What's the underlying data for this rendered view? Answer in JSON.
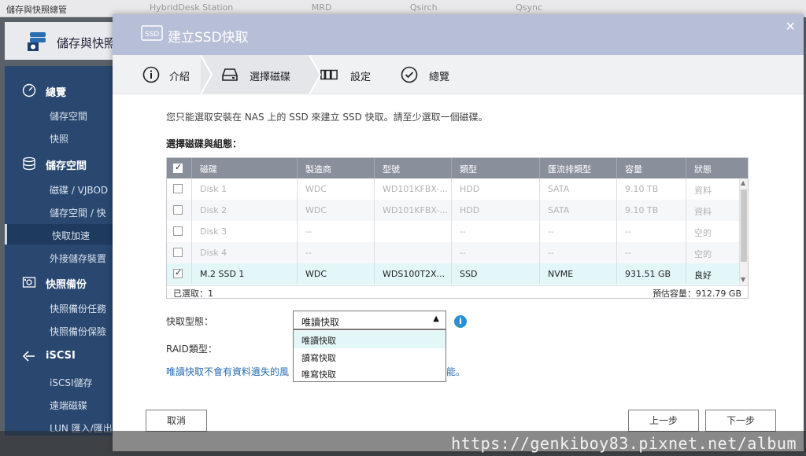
{
  "topbar": {
    "app_title": "儲存與快照總管",
    "bg_tabs": [
      "HybridDesk Station",
      "MRD",
      "Qsirch",
      "Qsync"
    ]
  },
  "app": {
    "name": "儲存與快照"
  },
  "sidebar": {
    "sections": [
      {
        "icon": "gauge-icon",
        "label": "總覽"
      },
      {
        "icon": "database-icon",
        "label": "儲存空間"
      },
      {
        "icon": "snapshot-icon",
        "label": "快照備份"
      },
      {
        "icon": "iscsi-icon",
        "label": "iSCSI"
      }
    ],
    "items": [
      "儲存空間",
      "快照",
      "磁碟 / VJBOD",
      "儲存空間 / 快",
      "快取加速",
      "外接儲存裝置",
      "快照備份任務",
      "快照備份保險",
      "iSCSI儲存",
      "遠端磁碟",
      "LUN 匯入/匯出"
    ]
  },
  "watermark": "https://genkiboy83.pixnet.net/album",
  "dialog": {
    "title": "建立SSD快取",
    "steps": [
      "介紹",
      "選擇磁碟",
      "設定",
      "總覽"
    ],
    "intro": "您只能選取安裝在 NAS 上的 SSD 來建立 SSD 快取。請至少選取一個磁碟。",
    "section_title": "選擇磁碟與組態：",
    "table": {
      "headers": [
        "磁碟",
        "製造商",
        "型號",
        "類型",
        "匯流排類型",
        "容量",
        "狀態"
      ],
      "rows": [
        {
          "checked": false,
          "cells": [
            "Disk 1",
            "WDC",
            "WD101KFBX-...",
            "HDD",
            "SATA",
            "9.10 TB",
            "資料"
          ]
        },
        {
          "checked": false,
          "cells": [
            "Disk 2",
            "WDC",
            "WD101KFBX-...",
            "HDD",
            "SATA",
            "9.10 TB",
            "資料"
          ]
        },
        {
          "checked": false,
          "cells": [
            "Disk 3",
            "--",
            "",
            "--",
            "--",
            "--",
            "空的"
          ]
        },
        {
          "checked": false,
          "cells": [
            "Disk 4",
            "--",
            "",
            "--",
            "--",
            "--",
            "空的"
          ]
        },
        {
          "checked": true,
          "cells": [
            "M.2 SSD 1",
            "WDC",
            "WDS100T2X...",
            "SSD",
            "NVME",
            "931.51 GB",
            "良好"
          ]
        }
      ],
      "footer_left": "已選取：1",
      "footer_right": "預估容量：912.79 GB"
    },
    "cache_type_label": "快取型態：",
    "cache_type_value": "唯讀快取",
    "raid_label": "RAID類型：",
    "dropdown_options": [
      "唯讀快取",
      "讀寫快取",
      "唯寫快取"
    ],
    "note_head": "唯讀快取不會有資料遺失的風",
    "note_tail": "能。",
    "buttons": {
      "cancel": "取消",
      "back": "上一步",
      "next": "下一步"
    }
  }
}
